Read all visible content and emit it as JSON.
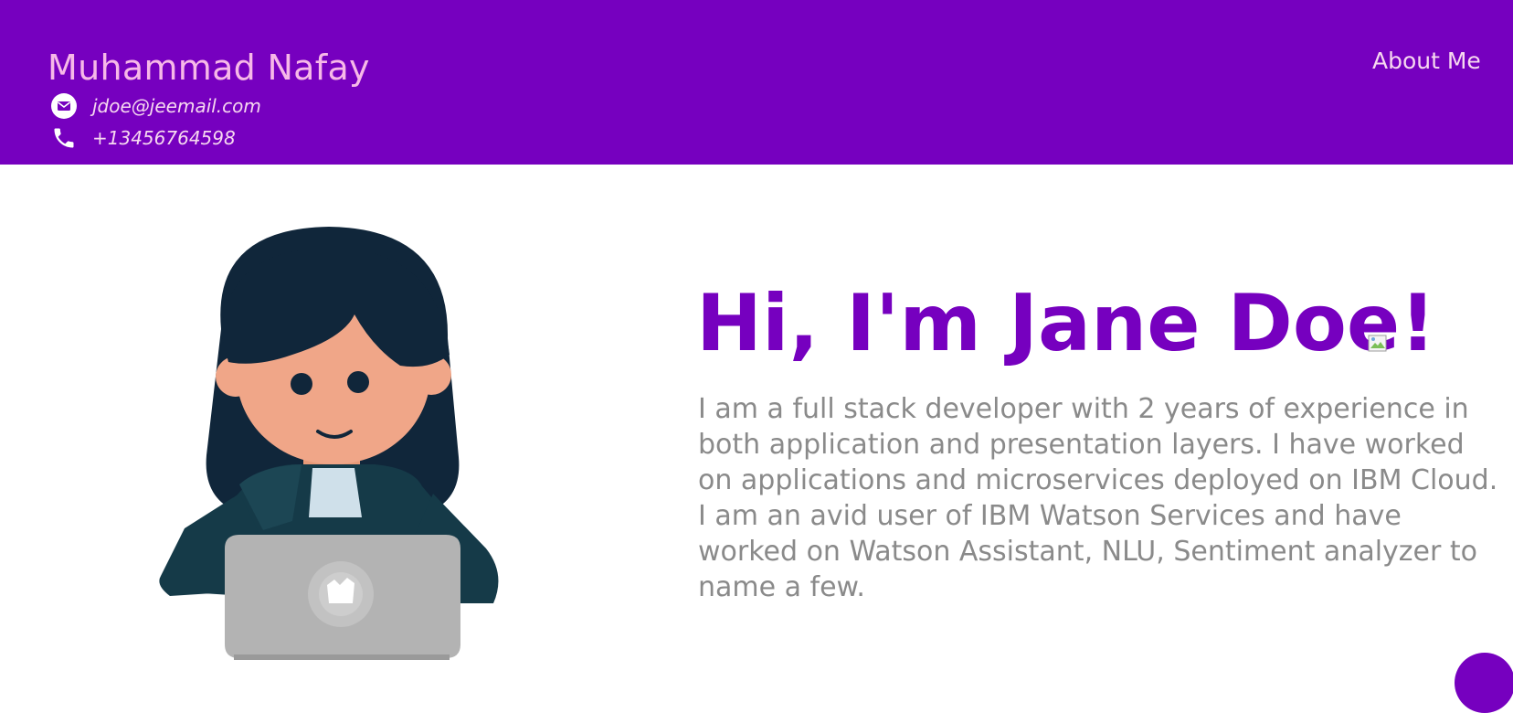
{
  "header": {
    "name": "Muhammad Nafay",
    "email": "jdoe@jeemail.com",
    "phone": "+13456764598",
    "nav": {
      "about_label": "About Me"
    }
  },
  "hero": {
    "title": "Hi, I'm Jane Doe!",
    "description": "I am a full stack developer with 2 years of experience in both application and presentation layers. I have worked on applications and microservices deployed on IBM Cloud. I am an avid user of IBM Watson Services and have worked on Watson Assistant, NLU, Sentiment analyzer to name a few."
  },
  "icons": {
    "email": "envelope-icon",
    "phone": "phone-icon",
    "chat": "chat-bubble-button"
  },
  "colors": {
    "brand": "#7600bf",
    "name_text": "#f7b8e8",
    "header_text": "#f7d8f0",
    "body_text": "#8a8a8a"
  }
}
